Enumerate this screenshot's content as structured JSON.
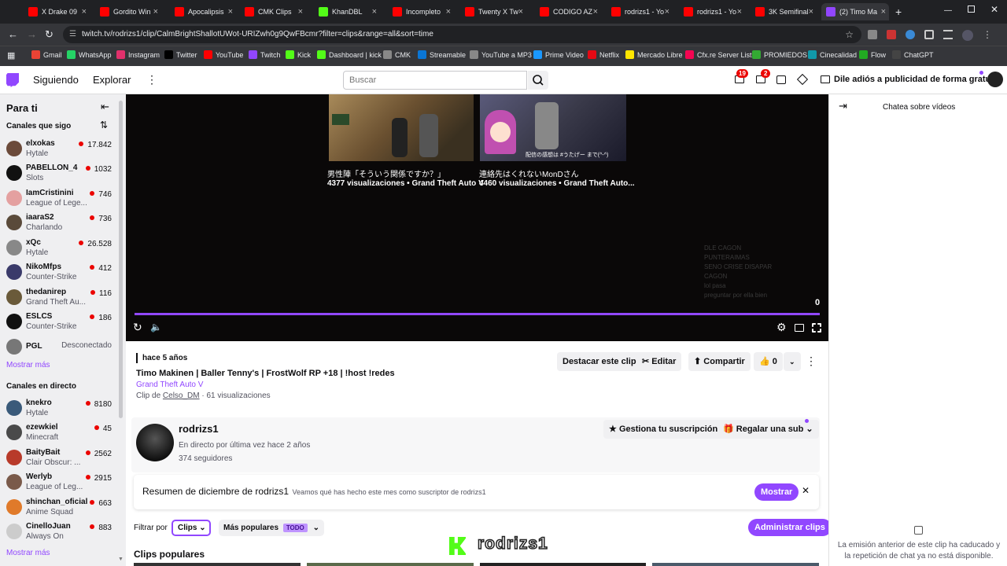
{
  "browser": {
    "tabs": [
      {
        "label": "X Drake 09",
        "color": "#ff0000"
      },
      {
        "label": "Gordito Win",
        "color": "#ff0000"
      },
      {
        "label": "Apocalipsis",
        "color": "#ff0000"
      },
      {
        "label": "CMK Clips",
        "color": "#ff0000"
      },
      {
        "label": "KhanDBL",
        "color": "#53fc18"
      },
      {
        "label": "Incompleto",
        "color": "#ff0000"
      },
      {
        "label": "Twenty X Tw",
        "color": "#ff0000"
      },
      {
        "label": "CODIGO AZ",
        "color": "#ff0000"
      },
      {
        "label": "rodrizs1 - Yo",
        "color": "#ff0000"
      },
      {
        "label": "rodrizs1 - Yo",
        "color": "#ff0000"
      },
      {
        "label": "3K Semifinal",
        "color": "#ff0000"
      },
      {
        "label": "(2) Timo Ma",
        "color": "#9146ff"
      }
    ],
    "url": "twitch.tv/rodrizs1/clip/CalmBrightShallotUWot-URIZwh0g9QwFBcmr?filter=clips&range=all&sort=time",
    "bookmarks": [
      "Gmail",
      "WhatsApp",
      "Instagram",
      "Twitter",
      "YouTube",
      "Twitch",
      "Kick",
      "Dashboard | kick",
      "CMK",
      "Streamable",
      "YouTube a MP3",
      "Prime Video",
      "Netflix",
      "Mercado Libre",
      "Cfx.re Server List",
      "PROMIEDOS",
      "Cinecalidad",
      "Flow",
      "ChatGPT"
    ]
  },
  "nav": {
    "following": "Siguiendo",
    "explore": "Explorar",
    "search_placeholder": "Buscar",
    "inbox_badge": "19",
    "notif_badge": "2",
    "ad_text": "Dile adiós a publicidad de forma gratuita"
  },
  "sidebar": {
    "for_you": "Para ti",
    "followed_header": "Canales que sigo",
    "followed": [
      {
        "name": "elxokas",
        "game": "Hytale",
        "viewers": "17.842",
        "color": "#6b4a3a"
      },
      {
        "name": "PABELLON_4",
        "game": "Slots",
        "viewers": "1032",
        "color": "#111111"
      },
      {
        "name": "IamCristinini",
        "game": "League of Lege...",
        "viewers": "746",
        "color": "#e4a0a0"
      },
      {
        "name": "iaaraS2",
        "game": "Charlando",
        "viewers": "736",
        "color": "#5a4a3a"
      },
      {
        "name": "xQc",
        "game": "Hytale",
        "viewers": "26.528",
        "color": "#888888"
      },
      {
        "name": "NikoMfps",
        "game": "Counter-Strike",
        "viewers": "412",
        "color": "#3a3a6a"
      },
      {
        "name": "thedanirep",
        "game": "Grand Theft Au...",
        "viewers": "116",
        "color": "#6a5a3a"
      },
      {
        "name": "ESLCS",
        "game": "Counter-Strike",
        "viewers": "186",
        "color": "#111111"
      },
      {
        "name": "PGL",
        "game": "",
        "viewers": "",
        "status": "Desconectado",
        "color": "#777777"
      }
    ],
    "show_more_1": "Mostrar más",
    "live_header": "Canales en directo",
    "live": [
      {
        "name": "knekro",
        "game": "Hytale",
        "viewers": "8180",
        "color": "#3a5a7a"
      },
      {
        "name": "ezewkiel",
        "game": "Minecraft",
        "viewers": "45",
        "color": "#4a4a4a"
      },
      {
        "name": "BaityBait",
        "game": "Clair Obscur: ...",
        "viewers": "2562",
        "color": "#b83a2a"
      },
      {
        "name": "Werlyb",
        "game": "League of Leg...",
        "viewers": "2915",
        "color": "#7a5a4a"
      },
      {
        "name": "shinchan_oficial",
        "game": "Anime Squad",
        "viewers": "663",
        "color": "#e07a2a"
      },
      {
        "name": "CinelloJuan",
        "game": "Always On",
        "viewers": "883",
        "color": "#cccccc"
      }
    ],
    "show_more_2": "Mostrar más"
  },
  "player": {
    "clip1_title": "男性陣「そういう関係ですか？」",
    "clip1_meta": "4377 visualizaciones • Grand Theft Auto V",
    "clip2_title": "連絡先はくれないMonDさん",
    "clip2_meta": "4460 visualizaciones • Grand Theft Auto...",
    "clip2_overlay": "配信の感想は #うたげー まで(^-^)",
    "counter": "0",
    "chat_lines": [
      "DLE CAGON",
      "PUNTERAIMAS",
      "SENO CRISE DISAPAR",
      "CAGON",
      "lol pasa",
      "preguntar por ella bien"
    ],
    "progress": 1.0
  },
  "clip": {
    "age": "hace 5 años",
    "title": "Timo Makinen | Baller Tenny's | FrostWolf RP +18 | !host !redes",
    "game": "Grand Theft Auto V",
    "clip_by_prefix": "Clip de",
    "clipper": "Celso_DM",
    "views": " · 61 visualizaciones",
    "feature_btn": "Destacar este clip",
    "edit_btn": "Editar",
    "share_btn": "Compartir",
    "likes": "0"
  },
  "channel": {
    "name": "rodrizs1",
    "last_live": "En directo por última vez hace 2 años",
    "followers": "374 seguidores",
    "manage_sub": "Gestiona tu suscripción",
    "gift_sub": "Regalar una sub"
  },
  "recap": {
    "title": "Resumen de diciembre de rodrizs1",
    "text": "Veamos qué has hecho este mes como suscriptor de rodrizs1",
    "show_btn": "Mostrar"
  },
  "filters": {
    "filter_label": "Filtrar por",
    "filter_value": "Clips",
    "sort_value": "Más populares",
    "range_badge": "TODO",
    "manage_btn": "Administrar clips",
    "section_title": "Clips populares"
  },
  "watermark": "rodrizs1",
  "chat": {
    "title": "Chatea sobre vídeos",
    "expired": "La emisión anterior de este clip ha caducado y la repetición de chat ya no está disponible."
  },
  "colors": {
    "accent": "#9147ff",
    "live": "#eb0400",
    "kick": "#53fc18"
  }
}
